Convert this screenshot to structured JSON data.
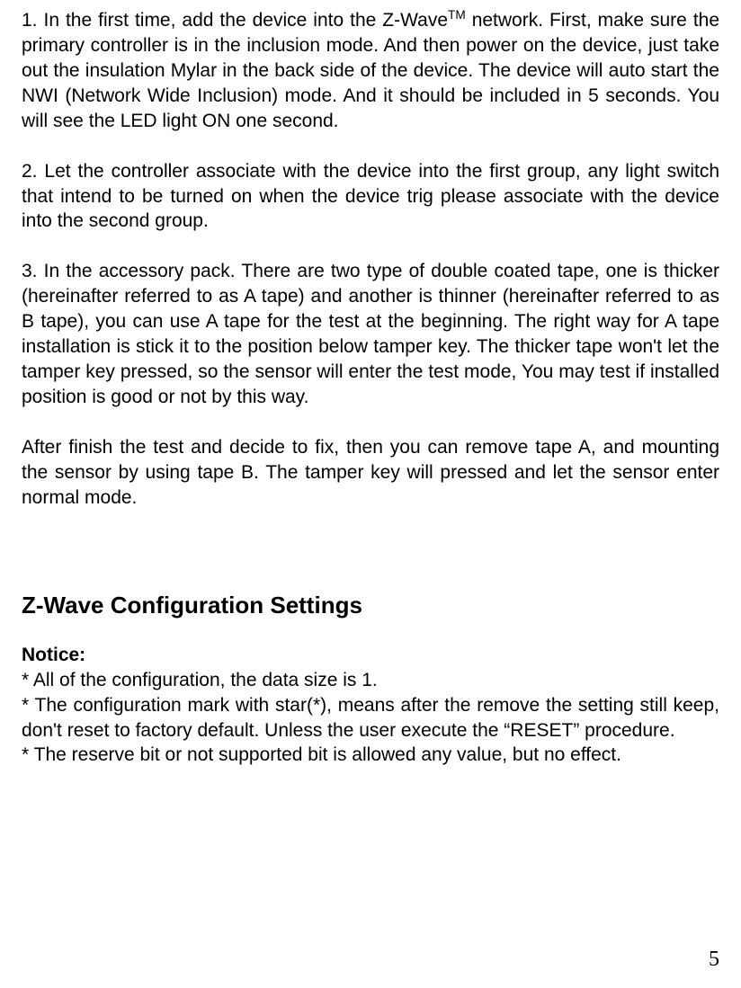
{
  "paragraphs": {
    "p1_pre": "1. In the first time, add the device into the Z-Wave",
    "p1_tm": "TM",
    "p1_post": " network.  First, make sure the primary controller is in the inclusion mode. And then power on the device, just take out the insulation Mylar in the back side of the device. The device will auto start the NWI (Network Wide Inclusion) mode. And it should be included in 5 seconds. You will see the LED light ON one second.",
    "p2": "2. Let the controller associate with the device into the first group, any light switch that intend to be turned on when the device trig please associate with the device into the second group.",
    "p3": "3. In the accessory pack. There are two type of double coated tape, one is thicker (hereinafter referred to as A tape)  and another is thinner (hereinafter referred to as B tape), you can use A tape for the test at the beginning. The right way for A tape installation is stick it to the position below tamper key. The thicker tape won't let the tamper key pressed, so the sensor will enter the test mode, You may test if installed position is good or not by this way.",
    "p4": "After finish the test and decide to fix, then you can remove tape A, and mounting the sensor by using tape B. The tamper key will pressed and let the sensor enter normal mode."
  },
  "section_heading": "Z-Wave Configuration Settings",
  "notice": {
    "label": "Notice:",
    "line1": "* All of the configuration, the data size is 1.",
    "line2": "* The configuration mark with star(*), means after the remove the setting still keep, don't reset to factory default. Unless the user execute the “RESET” procedure.",
    "line3": "* The reserve bit or not supported bit is allowed any value, but no effect."
  },
  "page_number": "5"
}
